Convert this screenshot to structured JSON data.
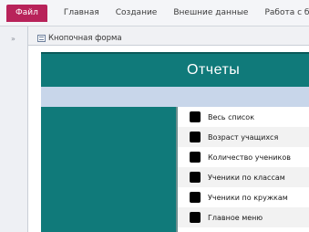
{
  "ribbon": {
    "file_tab": "Файл",
    "tabs": [
      "Главная",
      "Создание",
      "Внешние данные",
      "Работа с база"
    ]
  },
  "nav_pane": {
    "collapse_glyph": "»"
  },
  "document_tab": {
    "title": "Кнопочная форма"
  },
  "form": {
    "header_title": "Отчеты",
    "menu_items": [
      "Весь список",
      "Возраст учащихся",
      "Количество учеников",
      "Ученики по классам",
      "Ученики по кружкам",
      "Главное меню"
    ]
  }
}
